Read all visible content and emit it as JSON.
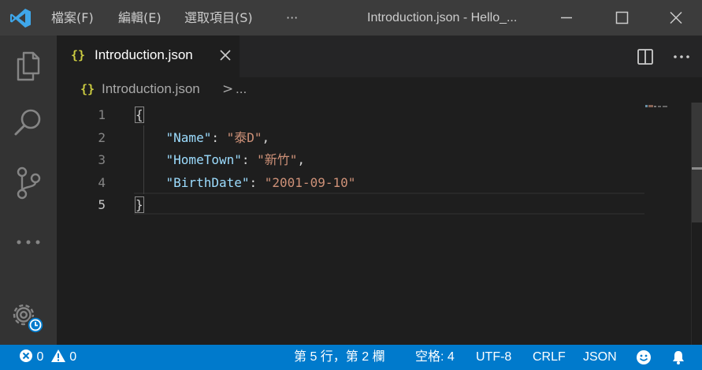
{
  "titlebar": {
    "menu": [
      "檔案(F)",
      "編輯(E)",
      "選取項目(S)",
      "···"
    ],
    "window_title": "Introduction.json - Hello_...",
    "buttons": [
      "minimize",
      "maximize",
      "close"
    ]
  },
  "activitybar": {
    "items": [
      "explorer-icon",
      "search-icon",
      "source-control-icon",
      "more-icon",
      "manage-gear-icon"
    ]
  },
  "tab": {
    "icon": "{}",
    "label": "Introduction.json"
  },
  "breadcrumb": {
    "icon": "{}",
    "file": "Introduction.json",
    "separator": ">",
    "more": "..."
  },
  "editor": {
    "line_numbers": [
      "1",
      "2",
      "3",
      "4",
      "5"
    ],
    "active_line": 5,
    "lines": [
      {
        "open": "{"
      },
      {
        "key": "\"Name\"",
        "colon": ": ",
        "value": "\"泰D\"",
        "comma": ","
      },
      {
        "key": "\"HomeTown\"",
        "colon": ": ",
        "value": "\"新竹\"",
        "comma": ","
      },
      {
        "key": "\"BirthDate\"",
        "colon": ": ",
        "value": "\"2001-09-10\"",
        "comma": ""
      },
      {
        "close": "}"
      }
    ]
  },
  "statusbar": {
    "errors": "0",
    "warnings": "0",
    "position": "第 5 行，第 2 欄",
    "spaces": "空格: 4",
    "encoding": "UTF-8",
    "eol": "CRLF",
    "language": "JSON"
  },
  "colors": {
    "accent": "#007acc",
    "titlebar": "#3c3c3c",
    "activitybar": "#333333",
    "editor_bg": "#1e1e1e",
    "json_key": "#9cdcfe",
    "json_string": "#ce9178",
    "json_icon": "#cbcb41"
  }
}
